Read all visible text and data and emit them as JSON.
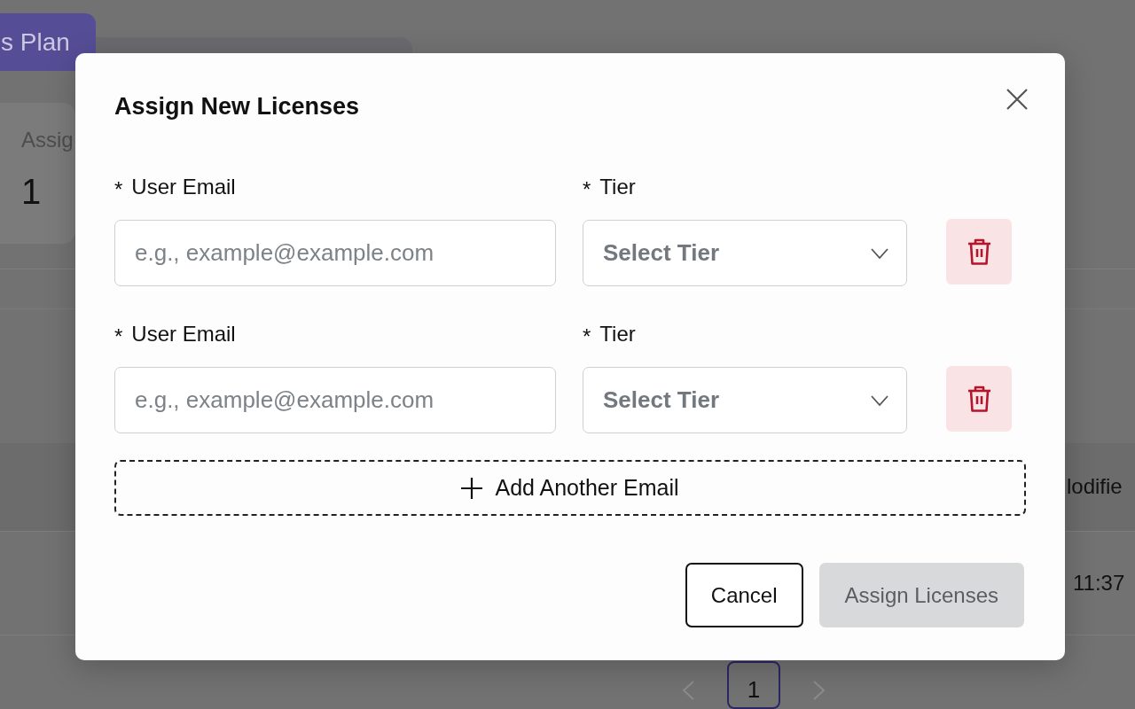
{
  "background": {
    "plan_tab": {
      "label": "s Plan"
    },
    "stat_card": {
      "label": "Assig",
      "value": "1"
    },
    "table": {
      "header_cell": "lodifie",
      "row_cell": "11:37"
    },
    "pagination": {
      "pages": [
        {
          "label": "1",
          "selected": true
        }
      ]
    }
  },
  "modal": {
    "title": "Assign New Licenses",
    "rows": [
      {
        "email": {
          "required_mark": "*",
          "label": "User Email",
          "placeholder": "e.g., example@example.com"
        },
        "tier": {
          "required_mark": "*",
          "label": "Tier",
          "placeholder": "Select Tier"
        }
      },
      {
        "email": {
          "required_mark": "*",
          "label": "User Email",
          "placeholder": "e.g., example@example.com"
        },
        "tier": {
          "required_mark": "*",
          "label": "Tier",
          "placeholder": "Select Tier"
        }
      }
    ],
    "add_button": {
      "label": "Add Another Email"
    },
    "buttons": [
      {
        "label": "Cancel",
        "kind": "default",
        "disabled": false
      },
      {
        "label": "Assign Licenses",
        "kind": "primary",
        "disabled": true
      }
    ]
  }
}
